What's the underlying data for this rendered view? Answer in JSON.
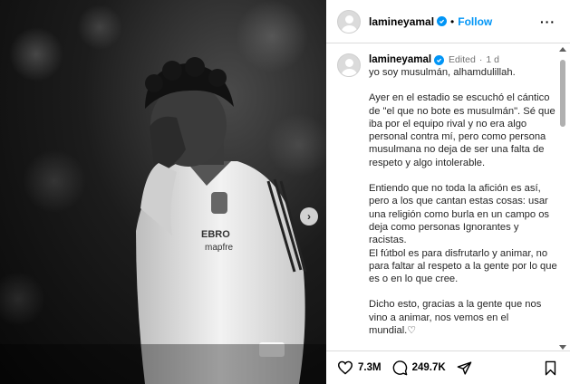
{
  "post": {
    "username": "lamineyamal",
    "follow_label": "Follow",
    "more_label": "···",
    "carousel_next": "›"
  },
  "comment": {
    "username": "lamineyamal",
    "edited": "Edited",
    "separator": "·",
    "time": "1 d",
    "paragraphs": [
      "yo soy musulmán, alhamdulillah.",
      "Ayer en el estadio se escuchó el cántico de \"el que no bote es musulmán\". Sé que iba por el equipo rival y no era algo personal contra mí, pero como persona musulmana no deja de ser una falta de respeto y algo intolerable.",
      "Entiendo que no toda la afición es así, pero a los que cantan estas cosas: usar una religión como burla en un campo os deja como personas Ignorantes y racistas.\nEl fútbol es para disfrutarlo y animar, no para faltar al respeto a la gente por lo que es o en lo que cree.",
      "Dicho esto, gracias a la gente que nos vino a animar, nos vemos en el mundial.♡"
    ]
  },
  "actions": {
    "likes": "7.3M",
    "comments": "249.7K"
  },
  "icons": {
    "verified": "verified-badge-icon",
    "like": "heart-icon",
    "comment": "comment-bubble-icon",
    "share": "paper-plane-icon",
    "save": "bookmark-icon"
  },
  "colors": {
    "accent": "#0095f6",
    "border": "#dbdbdb",
    "muted": "#737373"
  }
}
